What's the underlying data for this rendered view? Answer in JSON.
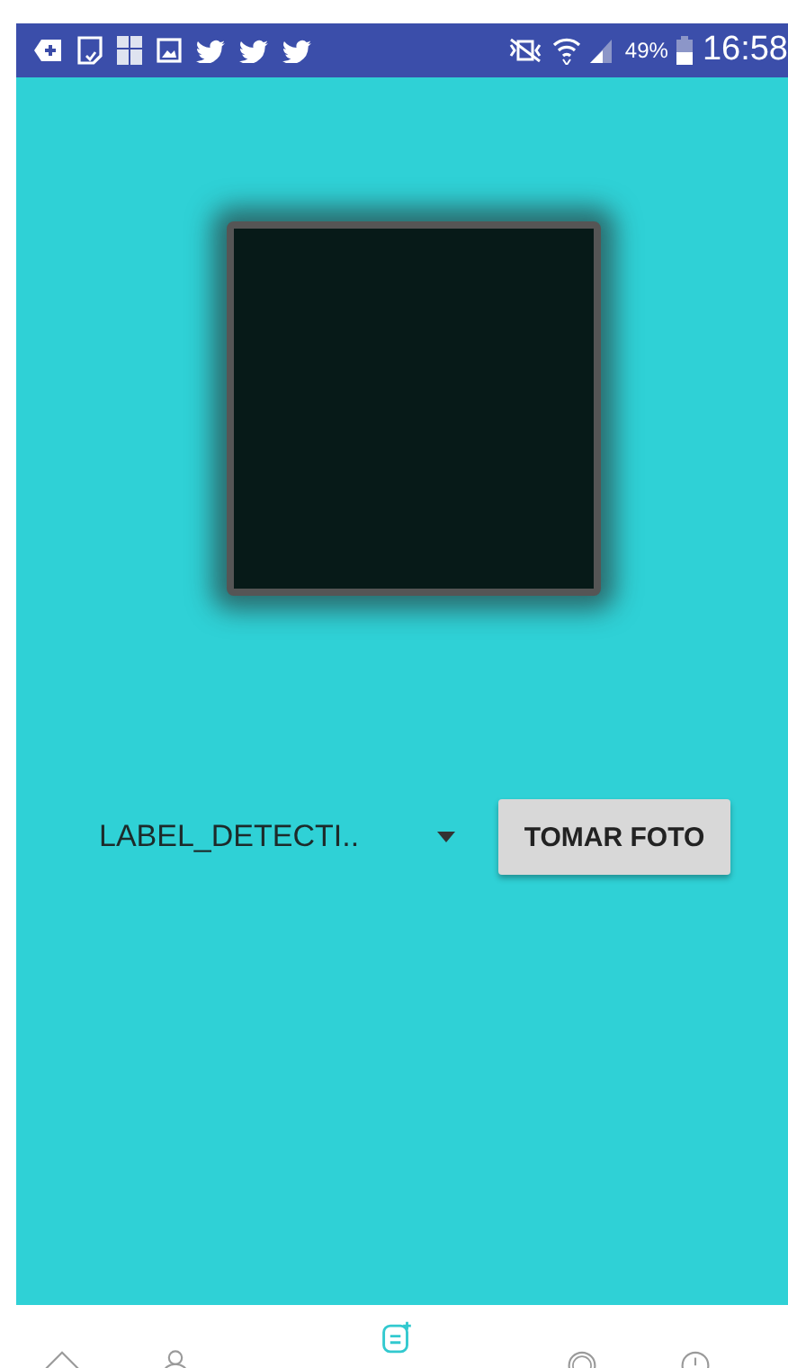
{
  "status_bar": {
    "battery": "49%",
    "time": "16:58"
  },
  "spinner": {
    "value": "LABEL_DETECTI.."
  },
  "button": "TOMAR FOTO",
  "bottom_nav": [
    {
      "selected": false
    },
    {
      "selected": false
    },
    {
      "selected": true
    },
    {
      "selected": false
    },
    {
      "selected": false
    }
  ]
}
